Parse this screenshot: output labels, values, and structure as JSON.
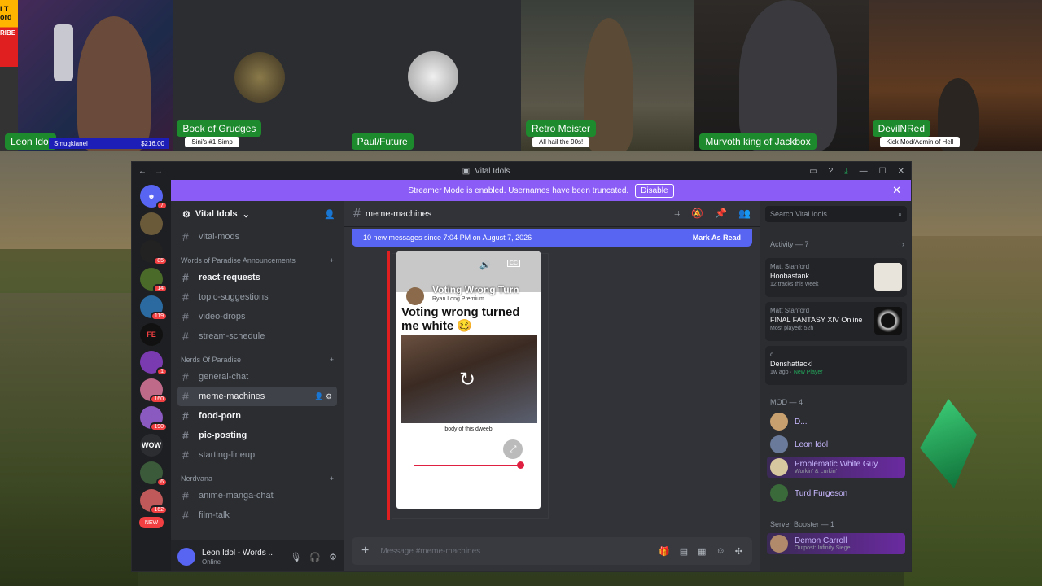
{
  "webcams": [
    {
      "name": "Leon Idol",
      "sub": "",
      "tip_user": "Smugklanel",
      "tip_amount": "$216.00",
      "side_text": [
        "LT",
        "ord",
        "RIBE"
      ]
    },
    {
      "name": "Book of Grudges",
      "sub": "Sini's #1 Simp"
    },
    {
      "name": "Paul/Future",
      "sub": ""
    },
    {
      "name": "Retro Meister",
      "sub": "All hail the 90s!"
    },
    {
      "name": "Murvoth king of Jackbox",
      "sub": ""
    },
    {
      "name": "DevilNRed",
      "sub": "Kick Mod/Admin of Hell"
    }
  ],
  "window": {
    "title": "Vital Idols",
    "banner_text": "Streamer Mode is enabled. Usernames have been truncated.",
    "banner_button": "Disable"
  },
  "servers": [
    {
      "label": "",
      "badge": "7"
    },
    {
      "label": "",
      "badge": ""
    },
    {
      "label": "",
      "badge": "85"
    },
    {
      "label": "",
      "badge": "14"
    },
    {
      "label": "",
      "badge": "119"
    },
    {
      "label": "FE",
      "badge": ""
    },
    {
      "label": "",
      "badge": "1"
    },
    {
      "label": "",
      "badge": "160"
    },
    {
      "label": "",
      "badge": "190"
    },
    {
      "label": "WOW",
      "badge": ""
    },
    {
      "label": "",
      "badge": "6"
    },
    {
      "label": "",
      "badge": "162"
    }
  ],
  "new_pill": "NEW",
  "sidebar": {
    "guild_name": "Vital Idols",
    "top_channel": "vital-mods",
    "categories": [
      {
        "name": "Words of Paradise Announcements",
        "channels": [
          {
            "name": "react-requests",
            "unread": true
          },
          {
            "name": "topic-suggestions",
            "unread": false
          },
          {
            "name": "video-drops",
            "unread": false
          },
          {
            "name": "stream-schedule",
            "unread": false
          }
        ]
      },
      {
        "name": "Nerds Of Paradise",
        "channels": [
          {
            "name": "general-chat",
            "unread": false
          },
          {
            "name": "meme-machines",
            "unread": false,
            "active": true
          },
          {
            "name": "food-porn",
            "unread": true
          },
          {
            "name": "pic-posting",
            "unread": true
          },
          {
            "name": "starting-lineup",
            "unread": false
          }
        ]
      },
      {
        "name": "Nerdvana",
        "channels": [
          {
            "name": "anime-manga-chat",
            "unread": false
          },
          {
            "name": "film-talk",
            "unread": false
          }
        ]
      }
    ],
    "user": {
      "name": "Leon Idol - Words ...",
      "status": "Online"
    }
  },
  "chat": {
    "channel": "meme-machines",
    "new_messages": "10 new messages since 7:04 PM on August 7, 2026",
    "mark_as_read": "Mark As Read",
    "video": {
      "overlay_title": "Voting Wrong Turn",
      "channel": "Ryan Long Premium",
      "caption": "Voting wrong turned me white 🥴",
      "body": "body of this dweeb"
    },
    "composer_placeholder": "Message #meme-machines"
  },
  "right_panel": {
    "search_placeholder": "Search Vital Idols",
    "activity_header": "Activity — 7",
    "activities": [
      {
        "user": "Matt Stanford",
        "title": "Hoobastank",
        "sub": "12 tracks this week"
      },
      {
        "user": "Matt Stanford",
        "title": "FINAL FANTASY XIV Online",
        "sub": "Most played: 52h"
      },
      {
        "user": "c...",
        "title": "Denshattack!",
        "sub": "1w ago",
        "sub2": "New Player"
      }
    ],
    "mod_header": "MOD — 4",
    "mods": [
      {
        "name": "D...",
        "sub": ""
      },
      {
        "name": "Leon Idol",
        "sub": ""
      },
      {
        "name": "Problematic White Guy",
        "sub": "Workin' & Lurkin'"
      },
      {
        "name": "Turd Furgeson",
        "sub": ""
      }
    ],
    "booster_header": "Server Booster — 1",
    "boosters": [
      {
        "name": "Demon Carroll",
        "sub": "Outpost: Infinity Siege"
      }
    ]
  },
  "colors": {
    "accent": "#5865f2",
    "banner": "#8b5cf6",
    "cam_label": "#1e8a2e",
    "badge": "#f23f42"
  }
}
